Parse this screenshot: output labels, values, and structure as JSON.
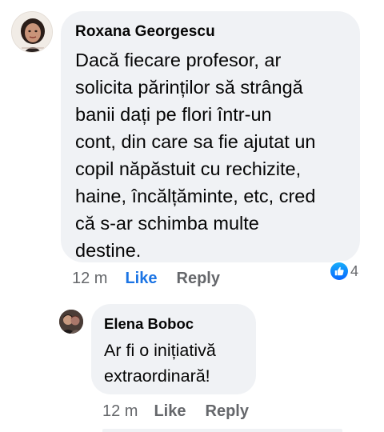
{
  "comments": [
    {
      "author": "Roxana Georgescu",
      "text": "Dacă fiecare profesor, ar\nsolicita părinților să strângă\nbanii dați pe flori  într-un\ncont, din care sa fie ajutat un\ncopil năpăstuit cu rechizite,\nhaine, încălțăminte, etc, cred\ncă s-ar schimba multe\ndestine.",
      "time": "12 m",
      "like_label": "Like",
      "reply_label": "Reply",
      "reaction_count": "4",
      "reaction_icon": "thumbs-up-icon",
      "like_state": "liked"
    },
    {
      "author": "Elena Boboc",
      "text": "Ar fi o inițiativă\nextraordinară!",
      "time": "12 m",
      "like_label": "Like",
      "reply_label": "Reply"
    }
  ],
  "colors": {
    "bubble": "#f0f2f5",
    "liked": "#1b74e4",
    "meta": "#65676b",
    "text": "#050505"
  }
}
